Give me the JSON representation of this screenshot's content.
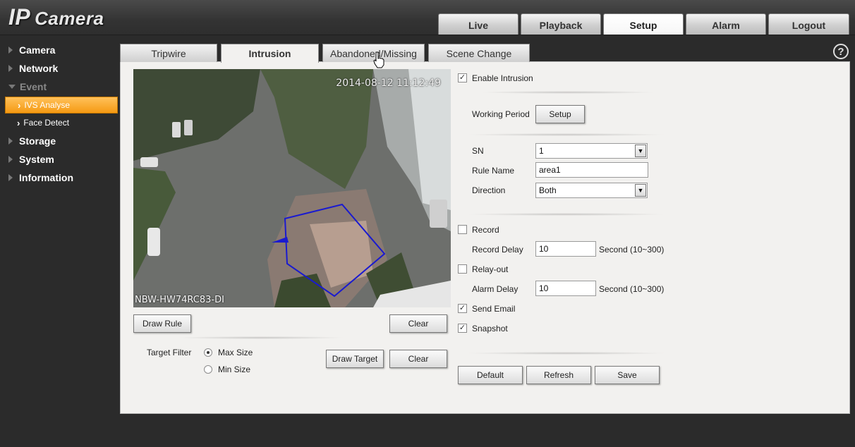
{
  "app": {
    "logo_ip": "IP",
    "logo_camera": "Camera"
  },
  "topnav": {
    "live": "Live",
    "playback": "Playback",
    "setup": "Setup",
    "alarm": "Alarm",
    "logout": "Logout"
  },
  "sidebar": {
    "camera": "Camera",
    "network": "Network",
    "event": "Event",
    "ivs_analyse": "IVS Analyse",
    "face_detect": "Face Detect",
    "storage": "Storage",
    "system": "System",
    "information": "Information"
  },
  "subtabs": {
    "tripwire": "Tripwire",
    "intrusion": "Intrusion",
    "abandoned": "Abandoned/Missing",
    "scene_change": "Scene Change"
  },
  "help": {
    "symbol": "?"
  },
  "video": {
    "timestamp": "2014-08-12 11:12:49",
    "camera_name": "NBW-HW74RC83-DI"
  },
  "rule": {
    "draw_rule": "Draw Rule",
    "clear": "Clear",
    "target_filter_label": "Target Filter",
    "max_size": "Max Size",
    "min_size": "Min Size",
    "draw_target": "Draw Target",
    "clear2": "Clear"
  },
  "form": {
    "enable_intrusion": "Enable Intrusion",
    "working_period_label": "Working Period",
    "setup_btn": "Setup",
    "sn_label": "SN",
    "sn_value": "1",
    "rule_name_label": "Rule Name",
    "rule_name_value": "area1",
    "direction_label": "Direction",
    "direction_value": "Both",
    "record": "Record",
    "record_delay_label": "Record Delay",
    "record_delay_value": "10",
    "record_delay_unit": "Second (10~300)",
    "relay_out": "Relay-out",
    "alarm_delay_label": "Alarm Delay",
    "alarm_delay_value": "10",
    "alarm_delay_unit": "Second (10~300)",
    "send_email": "Send Email",
    "snapshot": "Snapshot",
    "default_btn": "Default",
    "refresh_btn": "Refresh",
    "save_btn": "Save",
    "check_mark": "✓"
  }
}
